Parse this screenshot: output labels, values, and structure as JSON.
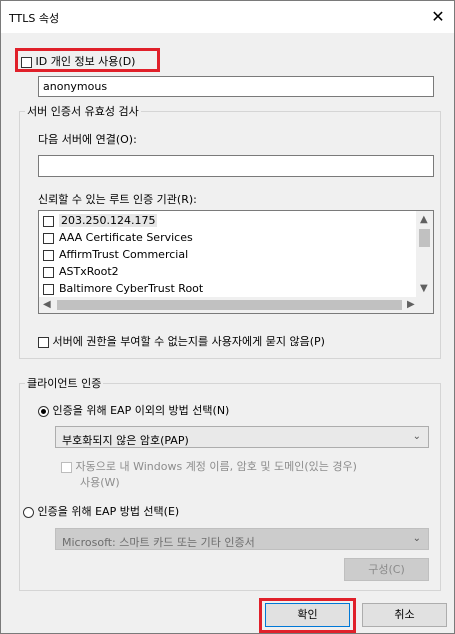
{
  "window": {
    "title": "TTLS 속성",
    "close_symbol": "✕"
  },
  "identity": {
    "checkbox_label": "ID 개인 정보 사용(D)",
    "value": "anonymous"
  },
  "server_validation": {
    "group_label": "서버 인증서 유효성 검사",
    "connect_label": "다음 서버에 연결(O):",
    "connect_value": "",
    "trusted_label": "신뢰할 수 있는 루트 인증 기관(R):",
    "root_cas": [
      {
        "name": "203.250.124.175",
        "checked": false
      },
      {
        "name": "AAA Certificate Services",
        "checked": false
      },
      {
        "name": "AffirmTrust Commercial",
        "checked": false
      },
      {
        "name": "ASTxRoot2",
        "checked": false
      },
      {
        "name": "Baltimore CyberTrust Root",
        "checked": false
      }
    ],
    "no_prompt_label": "서버에 권한을 부여할 수 없는지를 사용자에게 묻지 않음(P)"
  },
  "client_auth": {
    "group_label": "클라이언트 인증",
    "non_eap_label": "인증을 위해 EAP 이외의 방법 선택(N)",
    "non_eap_selected": true,
    "non_eap_method": "부호화되지 않은 암호(PAP)",
    "auto_windows_label_line1": "자동으로 내 Windows 계정 이름, 암호 및 도메인(있는 경우)",
    "auto_windows_label_line2": "사용(W)",
    "eap_label": "인증을 위해 EAP 방법 선택(E)",
    "eap_method": "Microsoft: 스마트 카드 또는 기타 인증서",
    "configure_label": "구성(C)"
  },
  "footer": {
    "ok_label": "확인",
    "cancel_label": "취소"
  },
  "colors": {
    "highlight": "#e0202a",
    "dialog_bg": "#f0f0f0"
  }
}
